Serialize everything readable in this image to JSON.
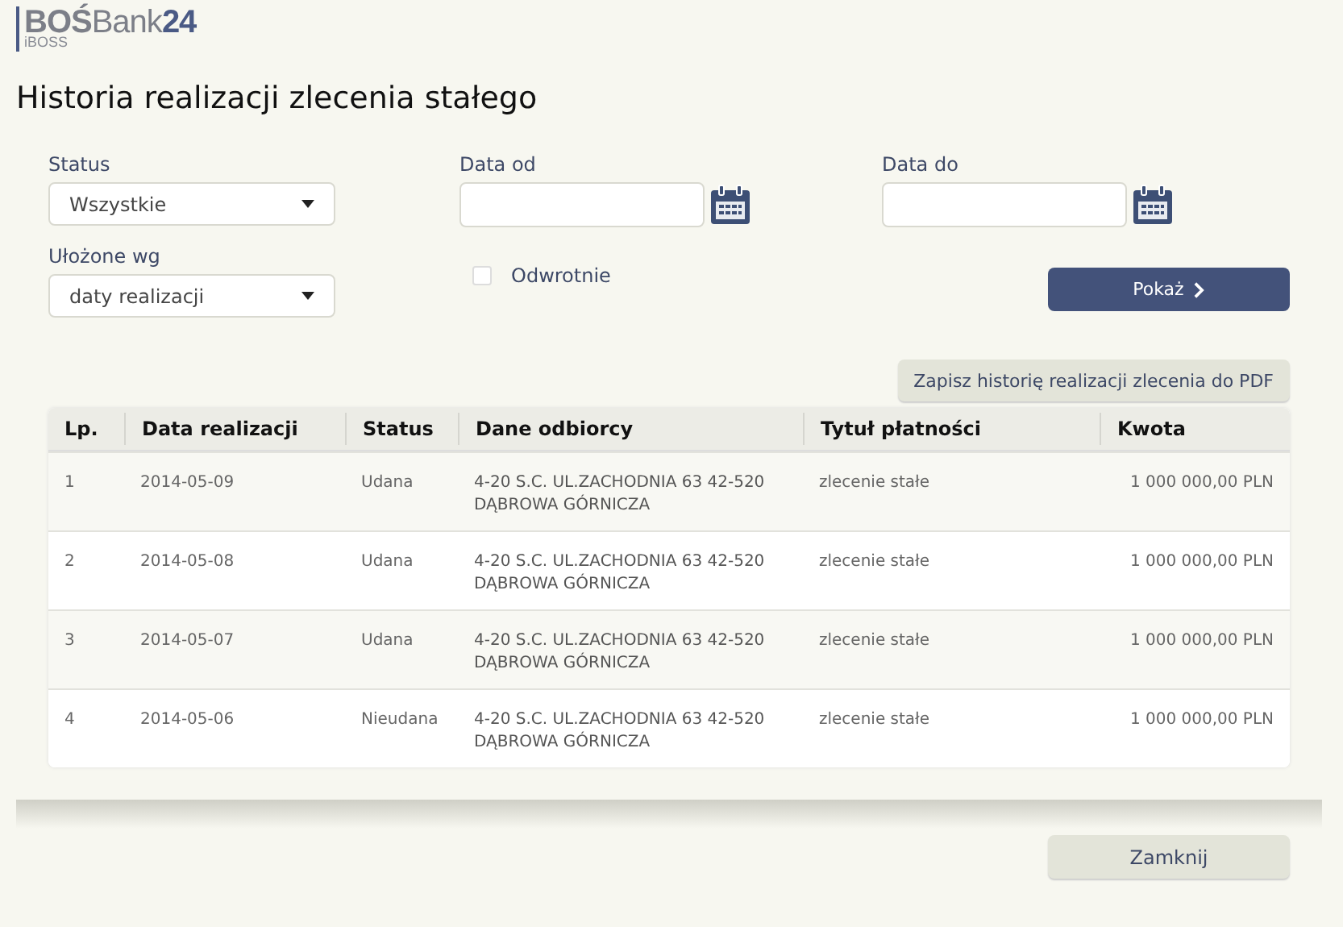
{
  "logo": {
    "parts": [
      "BOŚ",
      "Bank",
      "24"
    ],
    "subtitle": "iBOSS"
  },
  "title": "Historia realizacji zlecenia stałego",
  "filters": {
    "status": {
      "label": "Status",
      "value": "Wszystkie"
    },
    "date_from": {
      "label": "Data od"
    },
    "date_to": {
      "label": "Data do"
    },
    "sort": {
      "label": "Ułożone wg",
      "value": "daty realizacji"
    },
    "reverse": {
      "label": "Odwrotnie",
      "checked": false
    },
    "show_button": "Pokaż"
  },
  "pdf_button": "Zapisz historię realizacji zlecenia do PDF",
  "table": {
    "columns": [
      "Lp.",
      "Data realizacji",
      "Status",
      "Dane odbiorcy",
      "Tytuł płatności",
      "Kwota"
    ],
    "rows": [
      {
        "lp": "1",
        "date": "2014-05-09",
        "status": "Udana",
        "recipient": [
          "4-20 S.C. UL.ZACHODNIA 63 42-520",
          "DĄBROWA GÓRNICZA"
        ],
        "title": "zlecenie stałe",
        "amount": "1 000 000,00 PLN"
      },
      {
        "lp": "2",
        "date": "2014-05-08",
        "status": "Udana",
        "recipient": [
          "4-20 S.C. UL.ZACHODNIA 63 42-520",
          "DĄBROWA GÓRNICZA"
        ],
        "title": "zlecenie stałe",
        "amount": "1 000 000,00 PLN"
      },
      {
        "lp": "3",
        "date": "2014-05-07",
        "status": "Udana",
        "recipient": [
          "4-20 S.C. UL.ZACHODNIA 63 42-520",
          "DĄBROWA GÓRNICZA"
        ],
        "title": "zlecenie stałe",
        "amount": "1 000 000,00 PLN"
      },
      {
        "lp": "4",
        "date": "2014-05-06",
        "status": "Nieudana",
        "recipient": [
          "4-20 S.C. UL.ZACHODNIA 63 42-520",
          "DĄBROWA GÓRNICZA"
        ],
        "title": "zlecenie stałe",
        "amount": "1 000 000,00 PLN"
      }
    ]
  },
  "close_button": "Zamknij"
}
